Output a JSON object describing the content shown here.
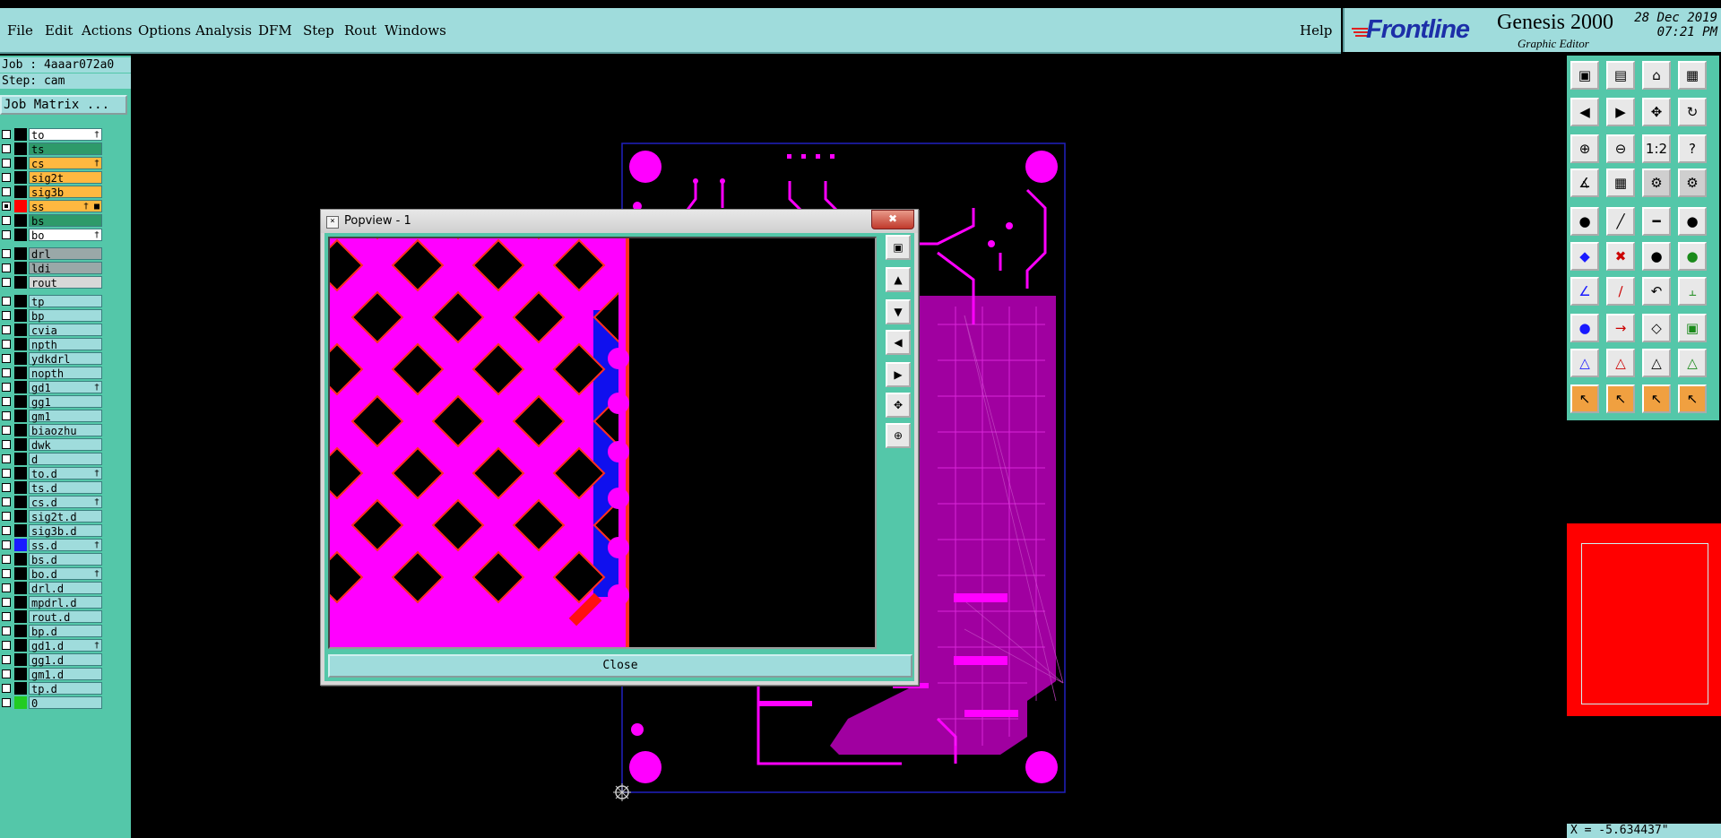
{
  "menu": {
    "items": [
      "File",
      "Edit",
      "Actions",
      "Options",
      "Analysis",
      "DFM",
      "Step",
      "Rout",
      "Windows"
    ],
    "help": "Help"
  },
  "brand": {
    "logo": "Frontline",
    "product": "Genesis 2000",
    "subtitle": "Graphic Editor",
    "date": "28 Dec 2019",
    "time": "07:21 PM"
  },
  "job": {
    "job_label": "Job : 4aaar072a0",
    "step_label": "Step: cam",
    "matrix_button": "Job Matrix ..."
  },
  "layers": [
    {
      "name": "to",
      "color": "#ffffff",
      "marker": "†"
    },
    {
      "name": "ts",
      "color": "#2e9a6a",
      "marker": ""
    },
    {
      "name": "cs",
      "color": "#ffb840",
      "marker": "†"
    },
    {
      "name": "sig2t",
      "color": "#ffb840",
      "marker": ""
    },
    {
      "name": "sig3b",
      "color": "#ffb840",
      "marker": ""
    },
    {
      "name": "ss",
      "color": "#ffb840",
      "marker": "† ■",
      "swatch": "#ff0000",
      "checked": true
    },
    {
      "name": "bs",
      "color": "#2e9a6a",
      "marker": ""
    },
    {
      "name": "bo",
      "color": "#ffffff",
      "marker": "†"
    },
    {
      "name": "drl",
      "color": "#9aa8a8",
      "marker": ""
    },
    {
      "name": "ldi",
      "color": "#9aa8a8",
      "marker": ""
    },
    {
      "name": "rout",
      "color": "#d8d8d8",
      "marker": ""
    },
    {
      "name": "tp",
      "color": "#9fdcdc",
      "marker": ""
    },
    {
      "name": "bp",
      "color": "#9fdcdc",
      "marker": ""
    },
    {
      "name": "cvia",
      "color": "#9fdcdc",
      "marker": ""
    },
    {
      "name": "npth",
      "color": "#9fdcdc",
      "marker": ""
    },
    {
      "name": "ydkdrl",
      "color": "#9fdcdc",
      "marker": ""
    },
    {
      "name": "nopth",
      "color": "#9fdcdc",
      "marker": ""
    },
    {
      "name": "gd1",
      "color": "#9fdcdc",
      "marker": "†"
    },
    {
      "name": "gg1",
      "color": "#9fdcdc",
      "marker": ""
    },
    {
      "name": "gm1",
      "color": "#9fdcdc",
      "marker": ""
    },
    {
      "name": "biaozhu",
      "color": "#9fdcdc",
      "marker": ""
    },
    {
      "name": "dwk",
      "color": "#9fdcdc",
      "marker": ""
    },
    {
      "name": "d",
      "color": "#9fdcdc",
      "marker": ""
    },
    {
      "name": "to.d",
      "color": "#9fdcdc",
      "marker": "†"
    },
    {
      "name": "ts.d",
      "color": "#9fdcdc",
      "marker": ""
    },
    {
      "name": "cs.d",
      "color": "#9fdcdc",
      "marker": "†"
    },
    {
      "name": "sig2t.d",
      "color": "#9fdcdc",
      "marker": ""
    },
    {
      "name": "sig3b.d",
      "color": "#9fdcdc",
      "marker": ""
    },
    {
      "name": "ss.d",
      "color": "#9fdcdc",
      "marker": "†",
      "swatch": "#1a1aff"
    },
    {
      "name": "bs.d",
      "color": "#9fdcdc",
      "marker": ""
    },
    {
      "name": "bo.d",
      "color": "#9fdcdc",
      "marker": "†"
    },
    {
      "name": "drl.d",
      "color": "#9fdcdc",
      "marker": ""
    },
    {
      "name": "mpdrl.d",
      "color": "#9fdcdc",
      "marker": ""
    },
    {
      "name": "rout.d",
      "color": "#9fdcdc",
      "marker": ""
    },
    {
      "name": "bp.d",
      "color": "#9fdcdc",
      "marker": ""
    },
    {
      "name": "gd1.d",
      "color": "#9fdcdc",
      "marker": "†"
    },
    {
      "name": "gg1.d",
      "color": "#9fdcdc",
      "marker": ""
    },
    {
      "name": "gm1.d",
      "color": "#9fdcdc",
      "marker": ""
    },
    {
      "name": "tp.d",
      "color": "#9fdcdc",
      "marker": ""
    },
    {
      "name": "0",
      "color": "#9fdcdc",
      "marker": "",
      "swatch": "#22cc22"
    }
  ],
  "tools": [
    "snap-icon",
    "zoom-home-icon",
    "home-icon",
    "layout-icon",
    "pan-left-icon",
    "pan-right-icon",
    "zoom-fit-icon",
    "redraw-icon",
    "zoom-in-icon",
    "zoom-out-icon",
    "scale-1-2-icon",
    "help-icon",
    "measure-icon",
    "grid-icon",
    "net-icon",
    "net-select-icon",
    "pad-icon",
    "route-icon",
    "ruler-icon",
    "dot-icon",
    "node-icon",
    "cross-icon",
    "segment-icon",
    "arc-segment-icon",
    "angle-icon",
    "line-icon",
    "arc-icon",
    "flip-icon",
    "pad-add-icon",
    "move-icon",
    "center-icon",
    "group-icon",
    "triangle-icon",
    "triangle-a-icon",
    "triangle-b-icon",
    "triangle-c-icon",
    "pointer-icon",
    "pointer-select-icon",
    "pointer-edit-icon",
    "pointer-tree-icon"
  ],
  "tool_glyphs": [
    "▣",
    "▤",
    "⌂",
    "▦",
    "◀",
    "▶",
    "✥",
    "↻",
    "⊕",
    "⊖",
    "1:2",
    "?",
    "∡",
    "▦",
    "⚙",
    "⚙",
    "●",
    "╱",
    "━",
    "●",
    "◆",
    "✖",
    "●",
    "●",
    "∠",
    "∕",
    "↶",
    "⫠",
    "●",
    "→",
    "◇",
    "▣",
    "△",
    "△",
    "△",
    "△",
    "↖",
    "↖",
    "↖",
    "↖"
  ],
  "popview": {
    "title": "Popview - 1",
    "close_x": "✖",
    "close_button": "Close"
  },
  "coordinate_readout": "X = -5.634437\""
}
